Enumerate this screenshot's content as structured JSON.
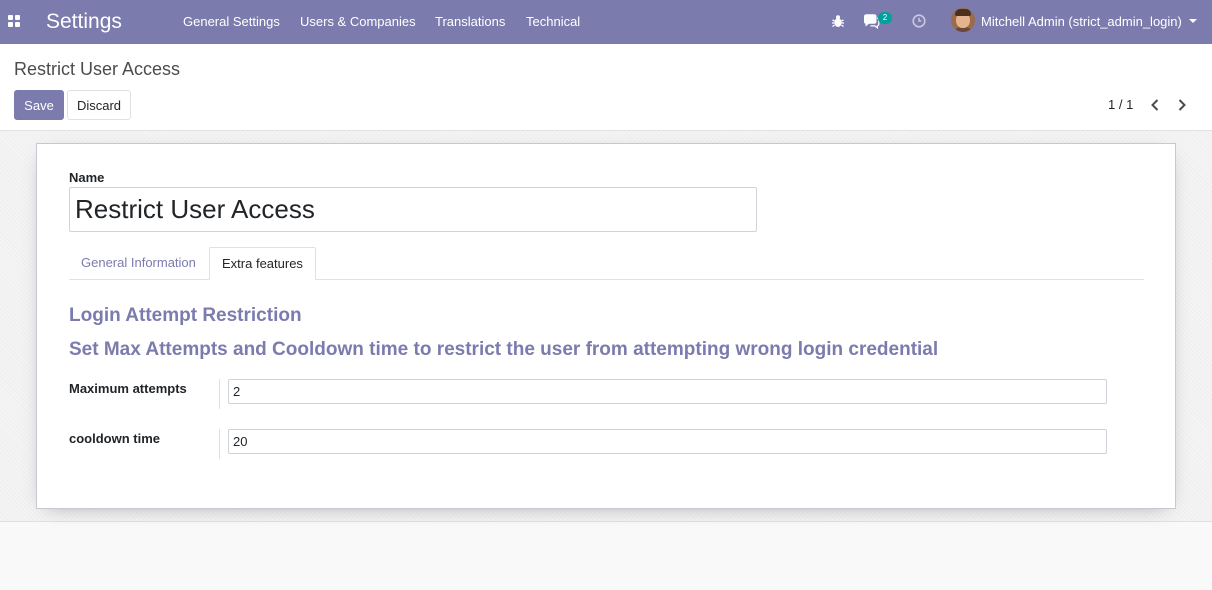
{
  "navbar": {
    "app_title": "Settings",
    "menu": [
      {
        "label": "General Settings"
      },
      {
        "label": "Users & Companies"
      },
      {
        "label": "Translations"
      },
      {
        "label": "Technical"
      }
    ],
    "messages_count": "2",
    "user_name": "Mitchell Admin (strict_admin_login)",
    "icons": [
      "apps-grid-icon",
      "bug-icon",
      "chat-icon",
      "clock-icon",
      "caret-down-icon"
    ],
    "color": "#7c7bad"
  },
  "control_panel": {
    "breadcrumb": "Restrict User Access",
    "save_label": "Save",
    "discard_label": "Discard",
    "pager": "1 / 1"
  },
  "form": {
    "name_label": "Name",
    "name_value": "Restrict User Access",
    "tabs": [
      {
        "label": "General Information",
        "active": false
      },
      {
        "label": "Extra features",
        "active": true
      }
    ],
    "section_title": "Login Attempt Restriction",
    "section_subtitle": "Set Max Attempts and Cooldown time to restrict the user from attempting wrong login credential",
    "fields": [
      {
        "label": "Maximum attempts",
        "value": "2"
      },
      {
        "label": "cooldown time",
        "value": "20"
      }
    ],
    "accent_color": "#7c7bad"
  }
}
